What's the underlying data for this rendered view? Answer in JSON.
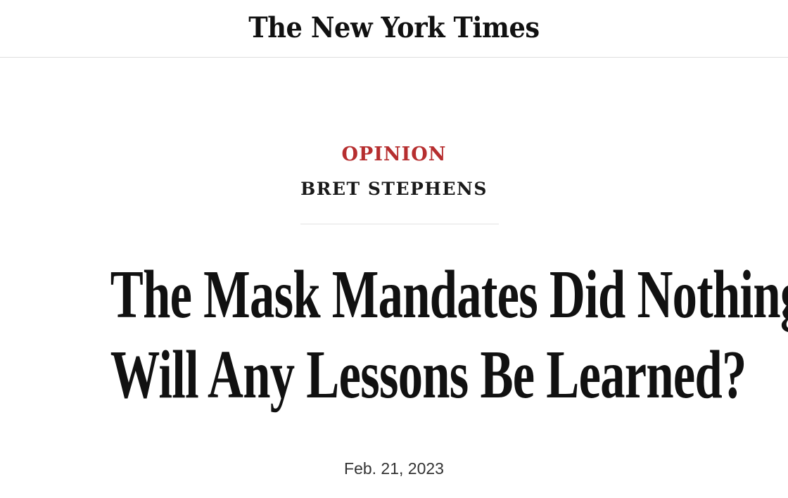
{
  "masthead": {
    "logo_text": "The New York Times"
  },
  "article": {
    "section": "OPINION",
    "author": "BRET STEPHENS",
    "headline_line1": "The Mask Mandates Did Nothing.",
    "headline_line2": "Will Any Lessons Be Learned?",
    "date": "Feb. 21, 2023"
  },
  "colors": {
    "section_accent": "#b62e2f",
    "text": "#121212",
    "divider": "#e2e2e2"
  }
}
